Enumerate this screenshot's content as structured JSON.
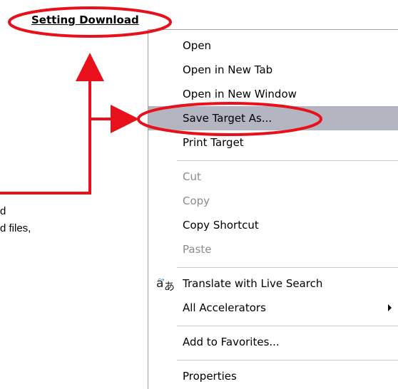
{
  "link": {
    "text": "Setting Download"
  },
  "background_text": {
    "line1": "d",
    "line2": "d files,"
  },
  "menu": {
    "items": [
      {
        "label": "Open",
        "disabled": false
      },
      {
        "label": "Open in New Tab",
        "disabled": false
      },
      {
        "label": "Open in New Window",
        "disabled": false
      },
      {
        "label": "Save Target As...",
        "disabled": false,
        "highlighted": true
      },
      {
        "label": "Print Target",
        "disabled": false
      },
      {
        "label": "Cut",
        "disabled": true
      },
      {
        "label": "Copy",
        "disabled": true
      },
      {
        "label": "Copy Shortcut",
        "disabled": false
      },
      {
        "label": "Paste",
        "disabled": true
      },
      {
        "label": "Translate with Live Search",
        "icon": "translate-icon",
        "disabled": false
      },
      {
        "label": "All Accelerators",
        "submenu": true,
        "disabled": false
      },
      {
        "label": "Add to Favorites...",
        "disabled": false
      },
      {
        "label": "Properties",
        "disabled": false
      }
    ]
  },
  "annotation": {
    "color": "#e8101a"
  }
}
